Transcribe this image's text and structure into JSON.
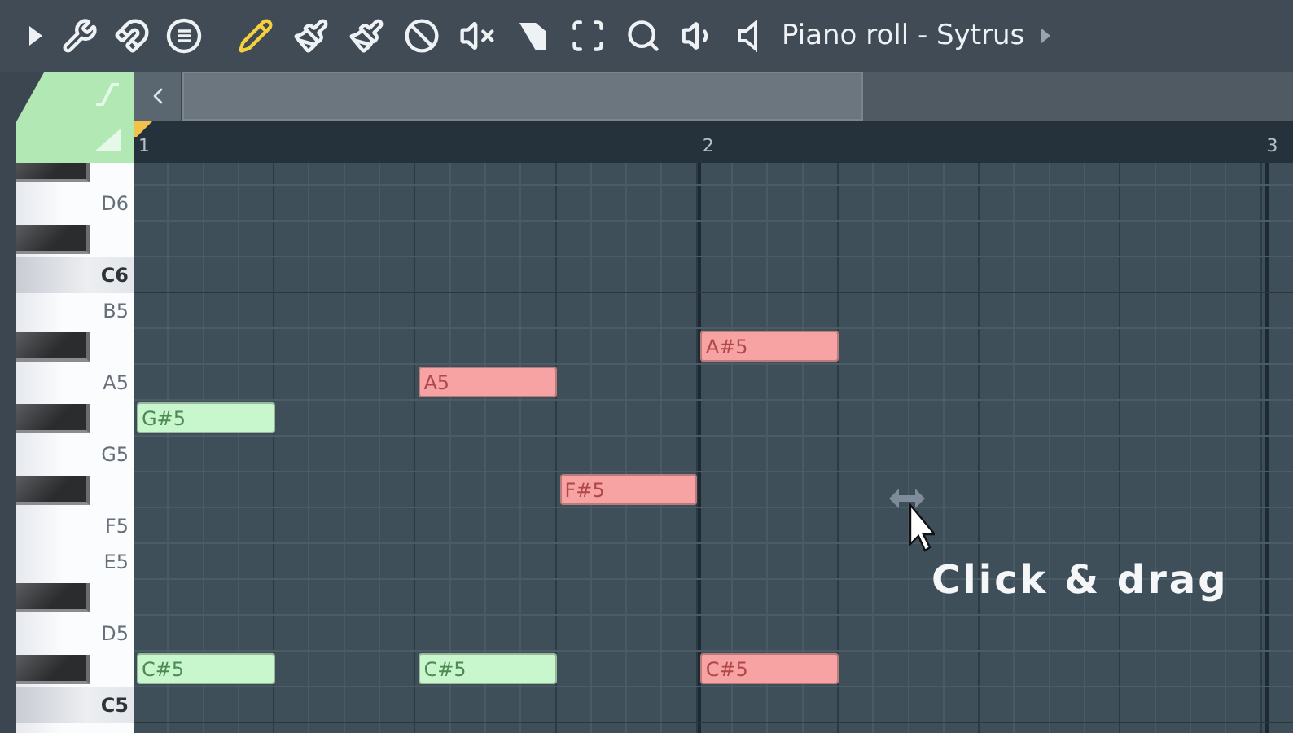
{
  "toolbar": {
    "title": "Piano roll - Sytrus"
  },
  "ruler": [
    "1",
    "2",
    "3"
  ],
  "rows": [
    {
      "kind": "black"
    },
    {
      "kind": "white",
      "label": "D6"
    },
    {
      "kind": "black"
    },
    {
      "kind": "c",
      "label": "C6"
    },
    {
      "kind": "white",
      "label": "B5"
    },
    {
      "kind": "black",
      "slots": [
        {
          "filled": false
        },
        {
          "filled": false
        },
        {
          "filled": false
        },
        {
          "filled": false
        },
        {
          "filled": true,
          "label": "A#5",
          "color": "#f7a3a3"
        }
      ]
    },
    {
      "kind": "white",
      "label": "A5",
      "slots": [
        {
          "filled": false
        },
        {
          "filled": false
        },
        {
          "filled": true,
          "label": "A5",
          "color": "#f7a3a3"
        }
      ]
    },
    {
      "kind": "black",
      "slots": [
        {
          "filled": true,
          "label": "G#5",
          "color": "#c9f7cd"
        }
      ]
    },
    {
      "kind": "white",
      "label": "G5"
    },
    {
      "kind": "black",
      "slots": [
        {
          "filled": false
        },
        {
          "filled": false
        },
        {
          "filled": false
        },
        {
          "filled": true,
          "label": "F#5",
          "color": "#f7a3a3"
        }
      ]
    },
    {
      "kind": "white",
      "label": "F5"
    },
    {
      "kind": "white",
      "label": "E5"
    },
    {
      "kind": "black"
    },
    {
      "kind": "white",
      "label": "D5"
    },
    {
      "kind": "black",
      "slots": [
        {
          "filled": true,
          "label": "C#5",
          "color": "#c9f7cd"
        },
        {
          "filled": false
        },
        {
          "filled": true,
          "label": "C#5",
          "color": "#c9f7cd"
        },
        {
          "filled": false
        },
        {
          "filled": true,
          "label": "C#5",
          "color": "#f7a3a3"
        }
      ]
    },
    {
      "kind": "c",
      "label": "C5"
    },
    {
      "kind": "white"
    }
  ],
  "hint": "Click & drag"
}
